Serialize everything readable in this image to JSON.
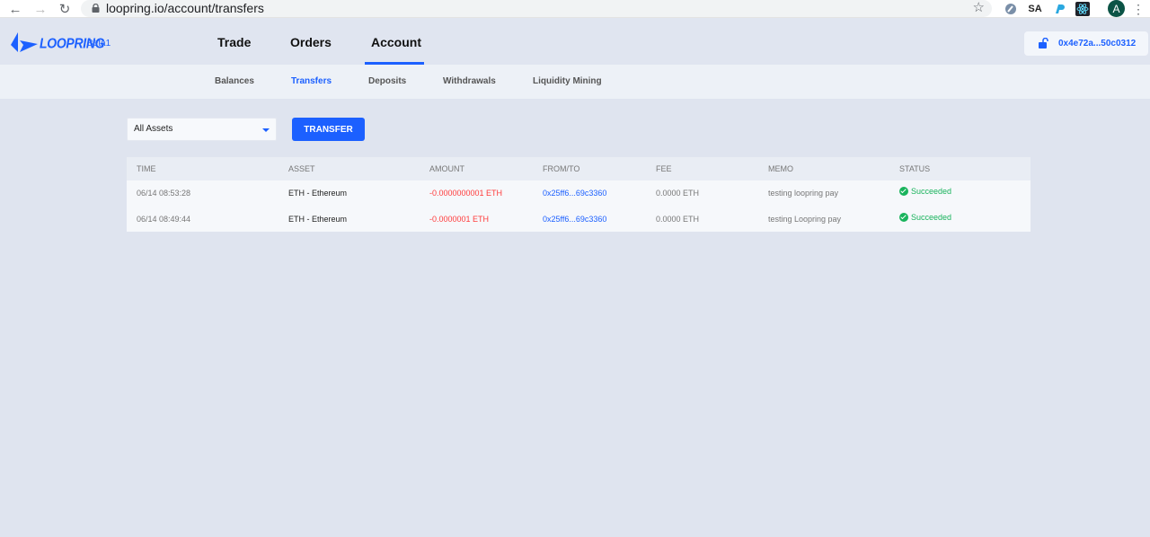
{
  "browser": {
    "url": "loopring.io/account/transfers",
    "profile_initial": "A",
    "ext_sa": "SA"
  },
  "brand": {
    "logo_text": "LOOPRING",
    "badge": "Beta1",
    "accent": "#1c60ff"
  },
  "main_tabs": [
    {
      "label": "Trade"
    },
    {
      "label": "Orders"
    },
    {
      "label": "Account",
      "active": true
    }
  ],
  "wallet": {
    "address": "0x4e72a...50c0312",
    "icon": "unlock-icon"
  },
  "sub_tabs": [
    {
      "label": "Balances"
    },
    {
      "label": "Transfers",
      "active": true
    },
    {
      "label": "Deposits"
    },
    {
      "label": "Withdrawals"
    },
    {
      "label": "Liquidity Mining"
    }
  ],
  "filter": {
    "selected": "All Assets"
  },
  "actions": {
    "transfer_label": "TRANSFER"
  },
  "table": {
    "columns": [
      "TIME",
      "ASSET",
      "AMOUNT",
      "FROM/TO",
      "FEE",
      "MEMO",
      "STATUS"
    ],
    "rows": [
      {
        "time": "06/14 08:53:28",
        "asset": "ETH - Ethereum",
        "amount": "-0.0000000001 ETH",
        "from_to": "0x25ff6...69c3360",
        "fee": "0.0000 ETH",
        "memo": "testing loopring pay",
        "status": "Succeeded"
      },
      {
        "time": "06/14 08:49:44",
        "asset": "ETH - Ethereum",
        "amount": "-0.0000001 ETH",
        "from_to": "0x25ff6...69c3360",
        "fee": "0.0000 ETH",
        "memo": "testing Loopring pay",
        "status": "Succeeded"
      }
    ]
  },
  "colors": {
    "negative": "#ff3b3b",
    "success": "#19b35c",
    "link": "#1c60ff"
  }
}
